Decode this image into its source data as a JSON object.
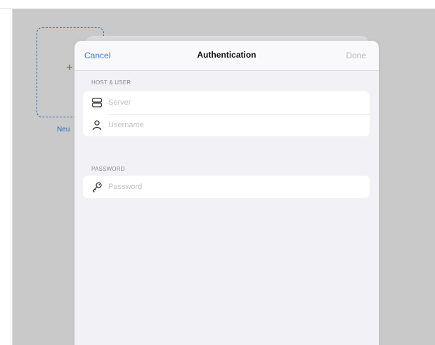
{
  "background": {
    "new_tile": {
      "plus": "+",
      "label": "Neu"
    }
  },
  "dialog": {
    "title": "Authentication",
    "cancel_label": "Cancel",
    "done_label": "Done",
    "sections": {
      "host_user": {
        "header": "HOST & USER",
        "server_placeholder": "Server",
        "username_placeholder": "Username"
      },
      "password": {
        "header": "PASSWORD",
        "password_placeholder": "Password"
      }
    }
  },
  "colors": {
    "accent": "#2f7bd7",
    "disabled": "#b8b8bd",
    "sheet_bg": "#f2f2f6"
  },
  "icons": [
    "server-icon",
    "person-icon",
    "key-icon"
  ]
}
